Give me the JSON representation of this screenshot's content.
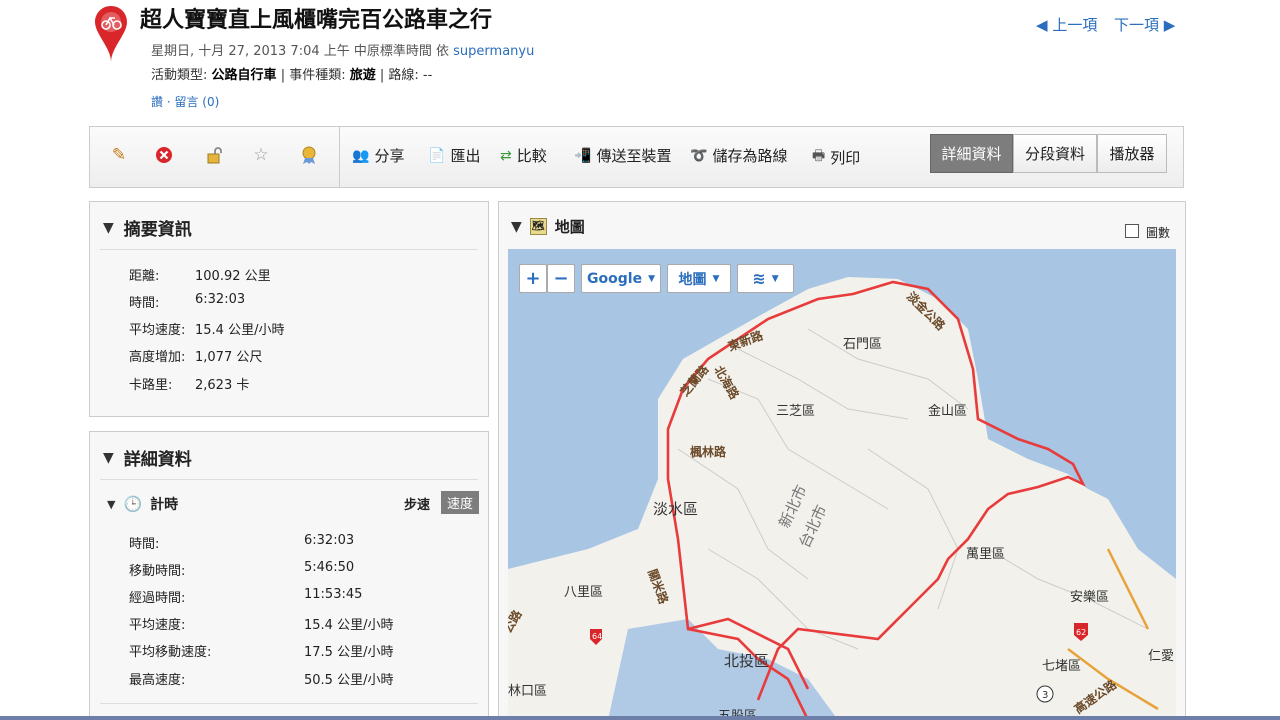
{
  "header": {
    "title": "超人寶寶直上風櫃嘴完百公路車之行",
    "nav_prev": "上一項",
    "nav_next": "下一項",
    "date_text": "星期日, 十月 27, 2013 7:04 上午 中原標準時間 依",
    "author": "supermanyu",
    "activity_type_label": "活動類型:",
    "activity_type": "公路自行車",
    "event_type_label": "| 事件種類:",
    "event_type": "旅遊",
    "course_label": "| 路線: --",
    "like": "讚",
    "comments": "留言 (0)"
  },
  "toolbar": {
    "share": "分享",
    "export": "匯出",
    "compare": "比較",
    "send_device": "傳送至裝置",
    "save_course": "儲存為路線",
    "print": "列印",
    "tabs": [
      "詳細資料",
      "分段資料",
      "播放器"
    ]
  },
  "summary": {
    "title": "摘要資訊",
    "rows": [
      {
        "label": "距離:",
        "value": "100.92 公里"
      },
      {
        "label": "時間:",
        "value": "6:32:03"
      },
      {
        "label": "平均速度:",
        "value": "15.4 公里/小時"
      },
      {
        "label": "高度增加:",
        "value": "1,077 公尺"
      },
      {
        "label": "卡路里:",
        "value": "2,623 卡"
      }
    ]
  },
  "details": {
    "title": "詳細資料",
    "timing_title": "計時",
    "pace": "步速",
    "speed": "速度",
    "rows": [
      {
        "label": "時間:",
        "value": "6:32:03"
      },
      {
        "label": "移動時間:",
        "value": "5:46:50"
      },
      {
        "label": "經過時間:",
        "value": "11:53:45"
      },
      {
        "label": "平均速度:",
        "value": "15.4 公里/小時"
      },
      {
        "label": "平均移動速度:",
        "value": "17.5 公里/小時"
      },
      {
        "label": "最高速度:",
        "value": "50.5 公里/小時"
      }
    ]
  },
  "map": {
    "title": "地圖",
    "chart_toggle": "圖數",
    "zoom_in": "+",
    "zoom_out": "−",
    "provider": "Google",
    "map_type": "地圖",
    "places": [
      "石門區",
      "三芝區",
      "金山區",
      "淡水區",
      "萬里區",
      "八里區",
      "北投區",
      "安樂區",
      "七堵區",
      "仁愛",
      "林口區",
      "五股區"
    ],
    "roads": [
      "淡金公路",
      "東新路",
      "北海路",
      "芝蘭路",
      "楓林路",
      "關米路",
      "新北市",
      "台北市",
      "公路",
      "高速公路"
    ],
    "shields": [
      "64",
      "62",
      "3"
    ]
  }
}
